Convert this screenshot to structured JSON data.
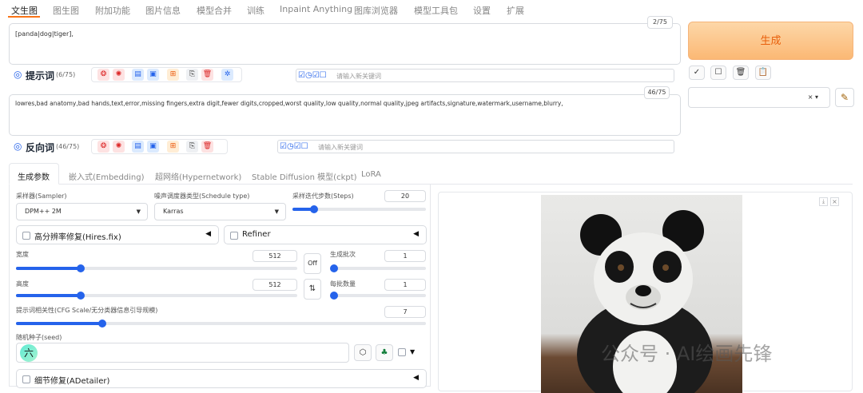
{
  "top_tabs": [
    "文生图",
    "图生图",
    "附加功能",
    "图片信息",
    "模型合并",
    "训练",
    "Inpaint Anything",
    "图库浏览器",
    "模型工具包",
    "设置",
    "扩展"
  ],
  "prompt": {
    "text": "[panda|dog|tiger],",
    "counter": "2/75",
    "label": "提示词",
    "count": "(6/75)",
    "keyword_placeholder": "请输入新关键词"
  },
  "negative": {
    "text": "lowres,bad anatomy,bad hands,text,error,missing fingers,extra digit,fewer digits,cropped,worst quality,low quality,normal quality,jpeg artifacts,signature,watermark,username,blurry,",
    "counter": "46/75",
    "label": "反向词",
    "count": "(46/75)",
    "keyword_placeholder": "请输入新关键词"
  },
  "generate_label": "生成",
  "style_clear": "× ▾",
  "param_tabs": [
    "生成参数",
    "嵌入式(Embedding)",
    "超网络(Hypernetwork)",
    "Stable Diffusion 模型(ckpt)",
    "LoRA"
  ],
  "params": {
    "sampler_label": "采样器(Sampler)",
    "sampler_value": "DPM++ 2M",
    "schedule_label": "噪声调度器类型(Schedule type)",
    "schedule_value": "Karras",
    "steps_label": "采样迭代步数(Steps)",
    "steps_value": "20",
    "steps_fraction": 0.16,
    "hires_label": "高分辨率修复(Hires.fix)",
    "refiner_label": "Refiner",
    "width_label": "宽度",
    "width_value": "512",
    "width_fraction": 0.23,
    "height_label": "高度",
    "height_value": "512",
    "height_fraction": 0.23,
    "off_label": "Off",
    "swap_icon": "⇅",
    "batch_count_label": "生成批次",
    "batch_count_value": "1",
    "batch_count_fraction": 0.0,
    "batch_size_label": "每批数量",
    "batch_size_value": "1",
    "batch_size_fraction": 0.0,
    "cfg_label": "提示词相关性(CFG Scale/无分类器信息引导规模)",
    "cfg_value": "7",
    "cfg_fraction": 0.21,
    "seed_label": "随机种子(seed)",
    "seed_avatar": "六",
    "adetailer_label": "细节修复(ADetailer)"
  },
  "watermark": "公众号 · AI绘画先锋",
  "colors": {
    "accent": "#f97316",
    "slider": "#2563eb",
    "generate_text": "#e8600c"
  }
}
